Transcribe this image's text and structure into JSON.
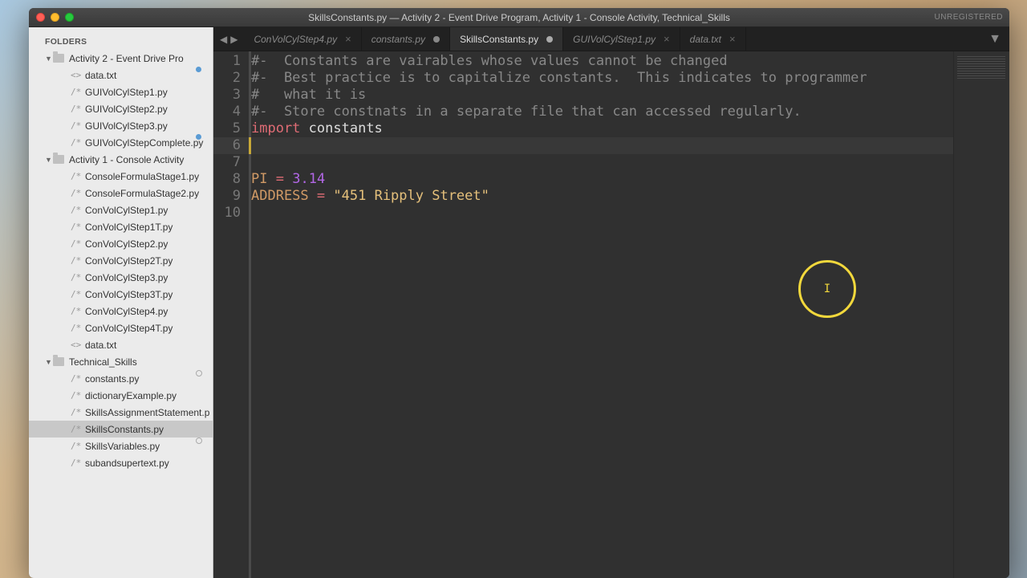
{
  "window": {
    "title": "SkillsConstants.py — Activity 2 - Event Drive Program, Activity 1 - Console Activity, Technical_Skills",
    "unregistered": "UNREGISTERED"
  },
  "sidebar": {
    "header": "FOLDERS",
    "folders": [
      {
        "name": "Activity 2 - Event Drive Pro",
        "mod": "blue",
        "files": [
          {
            "name": "data.txt",
            "icon": "<>"
          },
          {
            "name": "GUIVolCylStep1.py",
            "icon": "/*"
          },
          {
            "name": "GUIVolCylStep2.py",
            "icon": "/*"
          },
          {
            "name": "GUIVolCylStep3.py",
            "icon": "/*",
            "mod": "blue"
          },
          {
            "name": "GUIVolCylStepComplete.py",
            "icon": "/*"
          }
        ]
      },
      {
        "name": "Activity 1 - Console Activity",
        "files": [
          {
            "name": "ConsoleFormulaStage1.py",
            "icon": "/*"
          },
          {
            "name": "ConsoleFormulaStage2.py",
            "icon": "/*"
          },
          {
            "name": "ConVolCylStep1.py",
            "icon": "/*"
          },
          {
            "name": "ConVolCylStep1T.py",
            "icon": "/*"
          },
          {
            "name": "ConVolCylStep2.py",
            "icon": "/*"
          },
          {
            "name": "ConVolCylStep2T.py",
            "icon": "/*"
          },
          {
            "name": "ConVolCylStep3.py",
            "icon": "/*"
          },
          {
            "name": "ConVolCylStep3T.py",
            "icon": "/*"
          },
          {
            "name": "ConVolCylStep4.py",
            "icon": "/*"
          },
          {
            "name": "ConVolCylStep4T.py",
            "icon": "/*"
          },
          {
            "name": "data.txt",
            "icon": "<>"
          }
        ]
      },
      {
        "name": "Technical_Skills",
        "mod": "circle",
        "files": [
          {
            "name": "constants.py",
            "icon": "/*"
          },
          {
            "name": "dictionaryExample.py",
            "icon": "/*"
          },
          {
            "name": "SkillsAssignmentStatement.p",
            "icon": "/*"
          },
          {
            "name": "SkillsConstants.py",
            "icon": "/*",
            "selected": true,
            "mod": "circle"
          },
          {
            "name": "SkillsVariables.py",
            "icon": "/*"
          },
          {
            "name": "subandsupertext.py",
            "icon": "/*"
          }
        ]
      }
    ]
  },
  "tabs": {
    "nav_back": "◀",
    "nav_fwd": "▶",
    "items": [
      {
        "label": "ConVolCylStep4.py",
        "state": "close"
      },
      {
        "label": "constants.py",
        "state": "dirty"
      },
      {
        "label": "SkillsConstants.py",
        "state": "dirty",
        "active": true
      },
      {
        "label": "GUIVolCylStep1.py",
        "state": "close",
        "italic": true
      },
      {
        "label": "data.txt",
        "state": "close"
      }
    ],
    "dropdown": "▼"
  },
  "editor": {
    "lines": [
      {
        "n": "1",
        "tokens": [
          {
            "t": "#-  Constants are vairables whose values cannot be changed",
            "c": "cm"
          }
        ]
      },
      {
        "n": "2",
        "tokens": [
          {
            "t": "#-  Best practice is to capitalize constants.  This indicates to programmer",
            "c": "cm"
          }
        ]
      },
      {
        "n": "3",
        "tokens": [
          {
            "t": "#   what it is",
            "c": "cm"
          }
        ]
      },
      {
        "n": "4",
        "tokens": [
          {
            "t": "#-  Store constnats in a separate file that can accessed regularly.",
            "c": "cm"
          }
        ]
      },
      {
        "n": "5",
        "tokens": [
          {
            "t": "import",
            "c": "kw"
          },
          {
            "t": " ",
            "c": ""
          },
          {
            "t": "constants",
            "c": "ident"
          }
        ]
      },
      {
        "n": "6",
        "hl": true,
        "tokens": []
      },
      {
        "n": "7",
        "tokens": []
      },
      {
        "n": "8",
        "tokens": [
          {
            "t": "PI",
            "c": "var"
          },
          {
            "t": " ",
            "c": ""
          },
          {
            "t": "=",
            "c": "op"
          },
          {
            "t": " ",
            "c": ""
          },
          {
            "t": "3.14",
            "c": "num"
          }
        ]
      },
      {
        "n": "9",
        "tokens": [
          {
            "t": "ADDRESS",
            "c": "var"
          },
          {
            "t": " ",
            "c": ""
          },
          {
            "t": "=",
            "c": "op"
          },
          {
            "t": " ",
            "c": ""
          },
          {
            "t": "\"451 Ripply Street\"",
            "c": "str"
          }
        ]
      },
      {
        "n": "10",
        "tokens": []
      }
    ]
  },
  "annotation": {
    "cursor": "I"
  }
}
